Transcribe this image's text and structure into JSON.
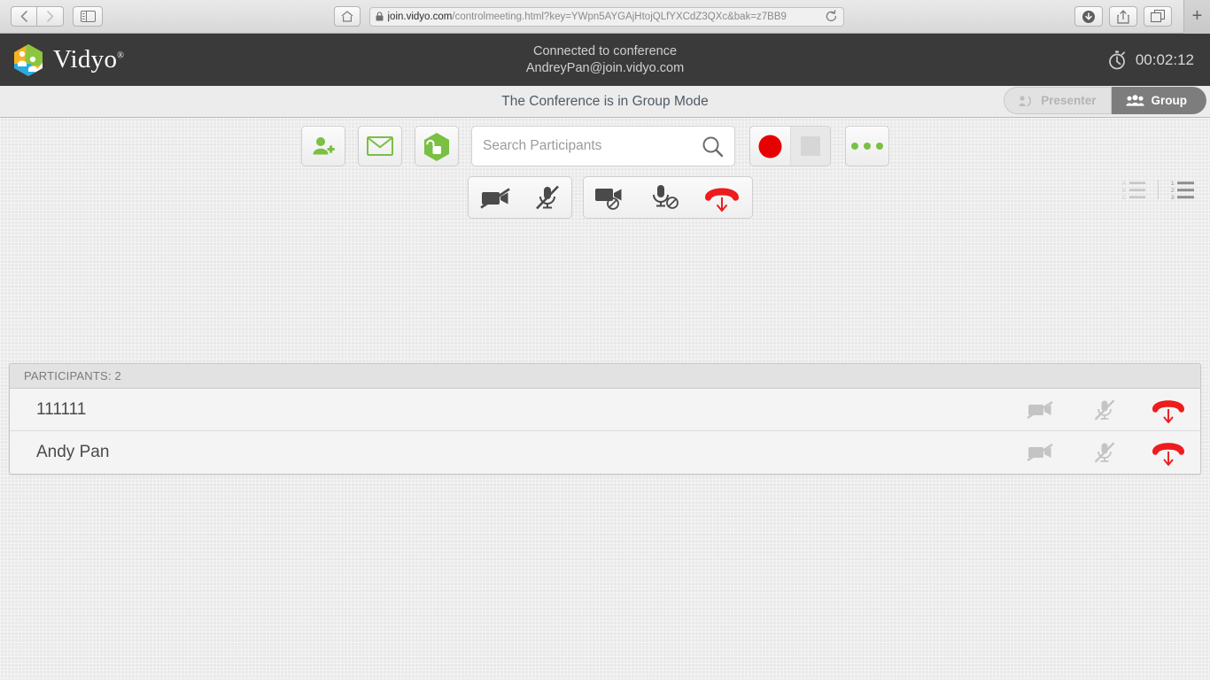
{
  "browser": {
    "back_icon": "back-chevron-icon",
    "forward_icon": "forward-chevron-icon",
    "sidebar_icon": "sidebar-toggle-icon",
    "home_icon": "home-icon",
    "url_host": "join.vidyo.com",
    "url_path": "/controlmeeting.html?key=YWpn5AYGAjHtojQLfYXCdZ3QXc&bak=z7BB9",
    "url_full": "join.vidyo.com/controlmeeting.html?key=YWpn5AYGAjHtojQLfYXCdZ3QXc&bak=z7BB9",
    "lock_icon": "padlock-icon",
    "reload_icon": "reload-icon",
    "download_icon": "download-icon",
    "share_icon": "share-icon",
    "tabs_icon": "show-tabs-icon",
    "newtab_label": "+"
  },
  "header": {
    "brand": "Vidyo",
    "brand_mark": "®",
    "status_line1": "Connected to conference",
    "status_line2": "AndreyPan@join.vidyo.com",
    "timer_icon": "stopwatch-icon",
    "timer": "00:02:12"
  },
  "mode_bar": {
    "message": "The Conference is in Group Mode",
    "presenter_label": "Presenter",
    "presenter_icon": "presenter-icon",
    "group_label": "Group",
    "group_icon": "group-people-icon",
    "active": "Group"
  },
  "toolbar": {
    "add_participant_icon": "add-person-icon",
    "invite_email_icon": "envelope-icon",
    "lock_room_icon": "unlocked-hexagon-icon",
    "record_icon": "record-circle-icon",
    "stop_icon": "stop-square-icon",
    "more_icon": "more-dots-icon",
    "mute_all_video_icon": "camera-off-icon",
    "mute_all_audio_icon": "microphone-off-icon",
    "disable_video_icon": "camera-disable-icon",
    "disable_audio_icon": "microphone-disable-icon",
    "disconnect_all_icon": "hangup-down-icon",
    "sort_alpha_icon": "sort-alphabetical-icon",
    "sort_alpha_labels": [
      "A",
      "B",
      "C"
    ],
    "sort_numeric_icon": "sort-numeric-icon",
    "sort_numeric_labels": [
      "1",
      "2",
      "3"
    ]
  },
  "search": {
    "placeholder": "Search Participants",
    "value": "",
    "icon": "search-magnifier-icon"
  },
  "participants": {
    "header": "PARTICIPANTS: 2",
    "count": 2,
    "rows": [
      {
        "name": "111111",
        "video_icon": "camera-off-icon",
        "audio_icon": "microphone-off-icon",
        "hangup_icon": "hangup-down-icon"
      },
      {
        "name": "Andy Pan",
        "video_icon": "camera-off-icon",
        "audio_icon": "microphone-off-icon",
        "hangup_icon": "hangup-down-icon"
      }
    ]
  },
  "colors": {
    "brand_green": "#79c043",
    "record_red": "#e60000",
    "hangup_red": "#ee1c1c",
    "header_dark": "#3a3a3a",
    "active_seg": "#7d7d7d"
  }
}
